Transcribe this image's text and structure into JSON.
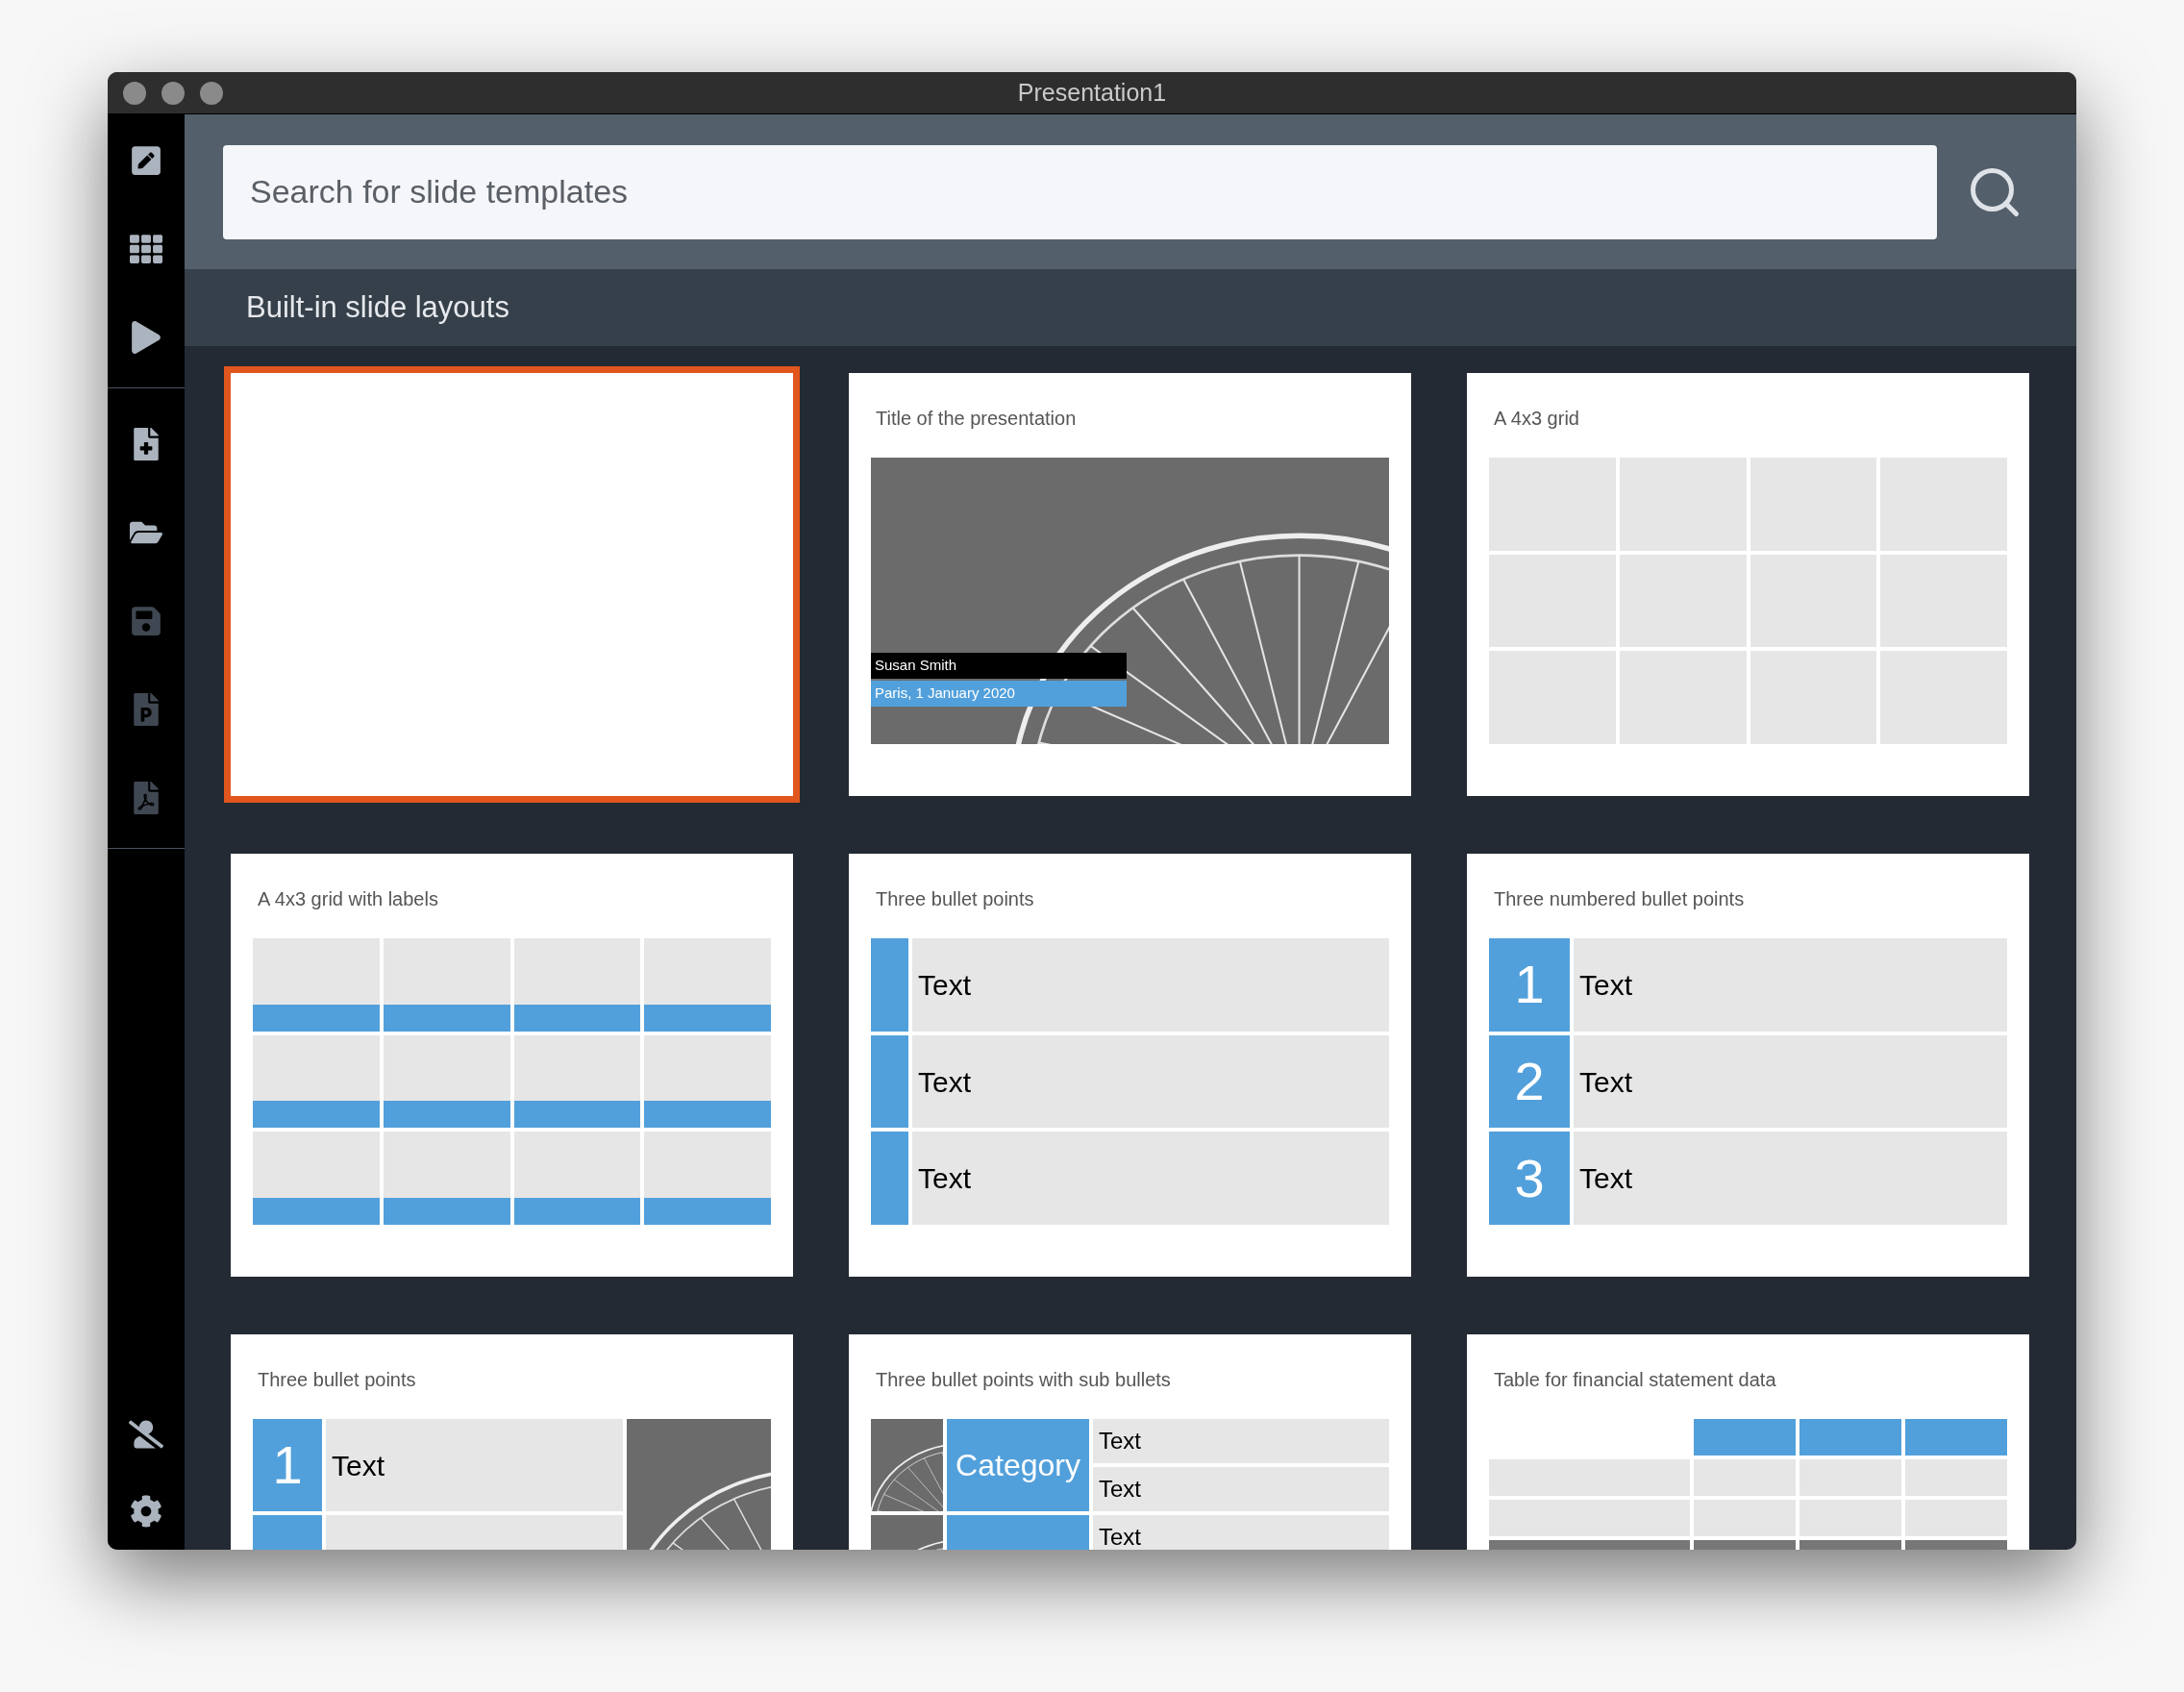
{
  "window": {
    "title": "Presentation1"
  },
  "sidebar": {
    "main_items": [
      {
        "disabled": false
      },
      {
        "disabled": false
      },
      {
        "disabled": false
      }
    ],
    "file_items": [
      {
        "disabled": false
      },
      {
        "disabled": false
      },
      {
        "disabled": true
      },
      {
        "disabled": true
      },
      {
        "disabled": true
      }
    ]
  },
  "search": {
    "placeholder": "Search for slide templates"
  },
  "section": {
    "title": "Built-in slide layouts"
  },
  "cards": [
    {
      "kind": "blank",
      "selected": true
    },
    {
      "kind": "title",
      "title": "Title of the presentation",
      "name": "Susan Smith",
      "date": "Paris, 1 January 2020",
      "selected": false
    },
    {
      "kind": "grid",
      "title": "A 4x3 grid",
      "selected": false
    },
    {
      "kind": "grid_labels",
      "title": "A 4x3 grid with labels",
      "selected": false
    },
    {
      "kind": "bullets",
      "title": "Three bullet points",
      "items": [
        "Text",
        "Text",
        "Text"
      ],
      "selected": false
    },
    {
      "kind": "numbered",
      "title": "Three numbered bullet points",
      "items": [
        {
          "number": "1",
          "text": "Text"
        },
        {
          "number": "2",
          "text": "Text"
        },
        {
          "number": "3",
          "text": "Text"
        }
      ],
      "selected": false
    },
    {
      "kind": "numbered_photo",
      "title": "Three bullet points",
      "items": [
        {
          "number": "1",
          "text": "Text"
        }
      ],
      "selected": false
    },
    {
      "kind": "sub_bullets",
      "title": "Three bullet points with sub bullets",
      "items": [
        {
          "category": "Category",
          "subs": [
            "Text",
            "Text"
          ]
        },
        {
          "subs": [
            "Text"
          ]
        }
      ],
      "selected": false
    },
    {
      "kind": "financial_table",
      "title": "Table for financial statement data",
      "selected": false
    }
  ]
}
